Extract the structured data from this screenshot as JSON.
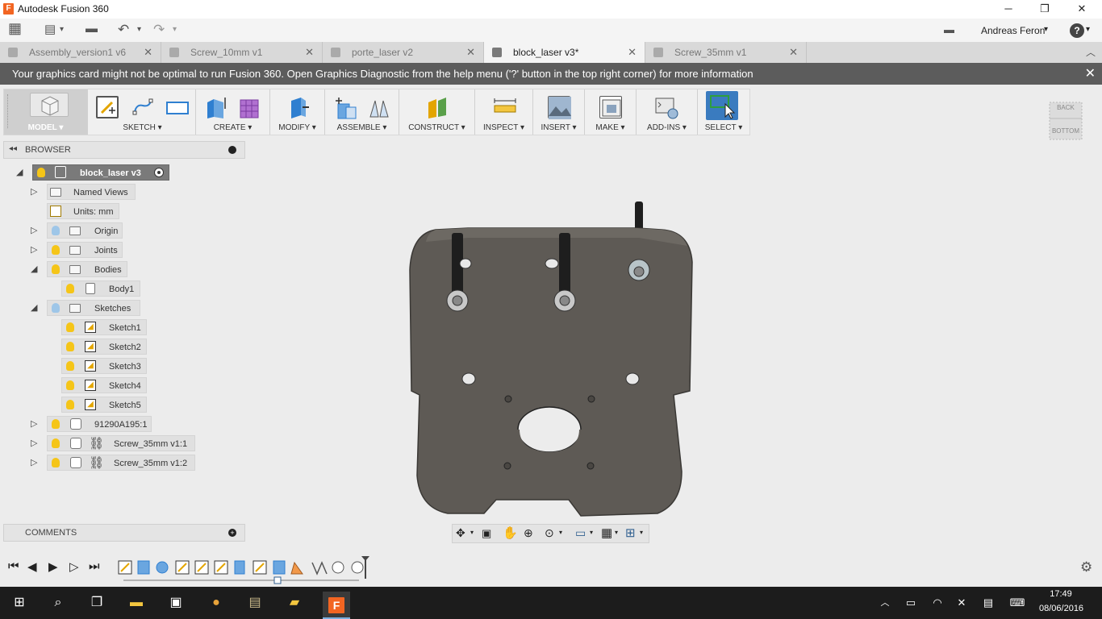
{
  "app": {
    "title": "Autodesk Fusion 360",
    "logo_letter": "F"
  },
  "user": {
    "name": "Andreas Feron"
  },
  "window_controls": {
    "minimize": "─",
    "restore": "❐",
    "close": "✕"
  },
  "quick_access": {
    "grid": "▦",
    "file": "▤",
    "save": "▬",
    "undo": "↶",
    "redo": "↷",
    "caret": "▾",
    "chat": "▬",
    "help": "?"
  },
  "tabs": [
    {
      "label": "Assembly_version1 v6",
      "active": false
    },
    {
      "label": "Screw_10mm v1",
      "active": false
    },
    {
      "label": "porte_laser v2",
      "active": false
    },
    {
      "label": "block_laser v3*",
      "active": true
    },
    {
      "label": "Screw_35mm v1",
      "active": false
    }
  ],
  "tab_close": "✕",
  "warning": {
    "text": "Your graphics card might not be optimal to run Fusion 360. Open Graphics Diagnostic from the help menu ('?' button in the top right corner) for more information",
    "close": "✕"
  },
  "ribbon": {
    "model": "MODEL ▾",
    "sketch": "SKETCH ▾",
    "create": "CREATE ▾",
    "modify": "MODIFY ▾",
    "assemble": "ASSEMBLE ▾",
    "construct": "CONSTRUCT ▾",
    "inspect": "INSPECT ▾",
    "insert": "INSERT ▾",
    "make": "MAKE ▾",
    "addins": "ADD-INS ▾",
    "select": "SELECT ▾"
  },
  "viewcube": {
    "top": "BACK",
    "front": "BOTTOM"
  },
  "browser": {
    "title": "BROWSER",
    "root": "block_laser v3",
    "named_views": "Named Views",
    "units": "Units: mm",
    "origin": "Origin",
    "joints": "Joints",
    "bodies": "Bodies",
    "body1": "Body1",
    "sketches": "Sketches",
    "sketch_items": [
      "Sketch1",
      "Sketch2",
      "Sketch3",
      "Sketch4",
      "Sketch5"
    ],
    "part": "91290A195:1",
    "screw1": "Screw_35mm v1:1",
    "screw2": "Screw_35mm v1:2"
  },
  "comments": {
    "title": "COMMENTS"
  },
  "taskbar": {
    "time": "17:49",
    "date": "08/06/2016"
  },
  "colors": {
    "warning_bar": "#5c5c5c",
    "part_body": "#5e5a55",
    "select_accent": "#3a7bbf",
    "fusion_orange": "#f26522"
  }
}
